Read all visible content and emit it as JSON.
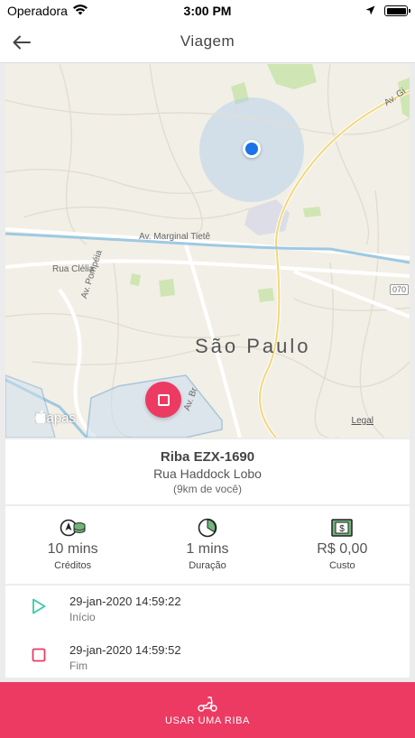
{
  "status_bar": {
    "carrier": "Operadora",
    "time": "3:00 PM",
    "icons": [
      "wifi-icon",
      "location-arrow-icon",
      "battery-icon"
    ]
  },
  "nav": {
    "title": "Viagem",
    "back_icon": "arrow-left-icon"
  },
  "map": {
    "city_label": "São Paulo",
    "street_labels": [
      "Av. Marginal Tietê",
      "Rua Clélia",
      "Av. Pompéia",
      "Av. Br",
      "Av. Gi",
      "070"
    ],
    "brand": "Mapas",
    "legal": "Legal",
    "stop_button_icon": "stop-square-icon"
  },
  "vehicle": {
    "name": "Riba EZX-1690",
    "address": "Rua Haddock Lobo",
    "distance": "(9km de você)"
  },
  "stats": [
    {
      "icon": "credits-coins-icon",
      "value": "10 mins",
      "label": "Créditos"
    },
    {
      "icon": "clock-pie-icon",
      "value": "1 mins",
      "label": "Duração"
    },
    {
      "icon": "money-bill-icon",
      "value": "R$ 0,00",
      "label": "Custo"
    }
  ],
  "timeline": [
    {
      "icon": "play-icon",
      "date": "29-jan-2020 14:59:22",
      "label": "Início",
      "color": "#3cc9a7"
    },
    {
      "icon": "stop-square-icon",
      "date": "29-jan-2020 14:59:52",
      "label": "Fim",
      "color": "#ec3a63"
    }
  ],
  "cta": {
    "label": "USAR UMA RIBA",
    "icon": "scooter-icon"
  },
  "colors": {
    "accent": "#ec3a63",
    "start_green": "#3cc9a7",
    "location_blue": "#1a73e8"
  }
}
